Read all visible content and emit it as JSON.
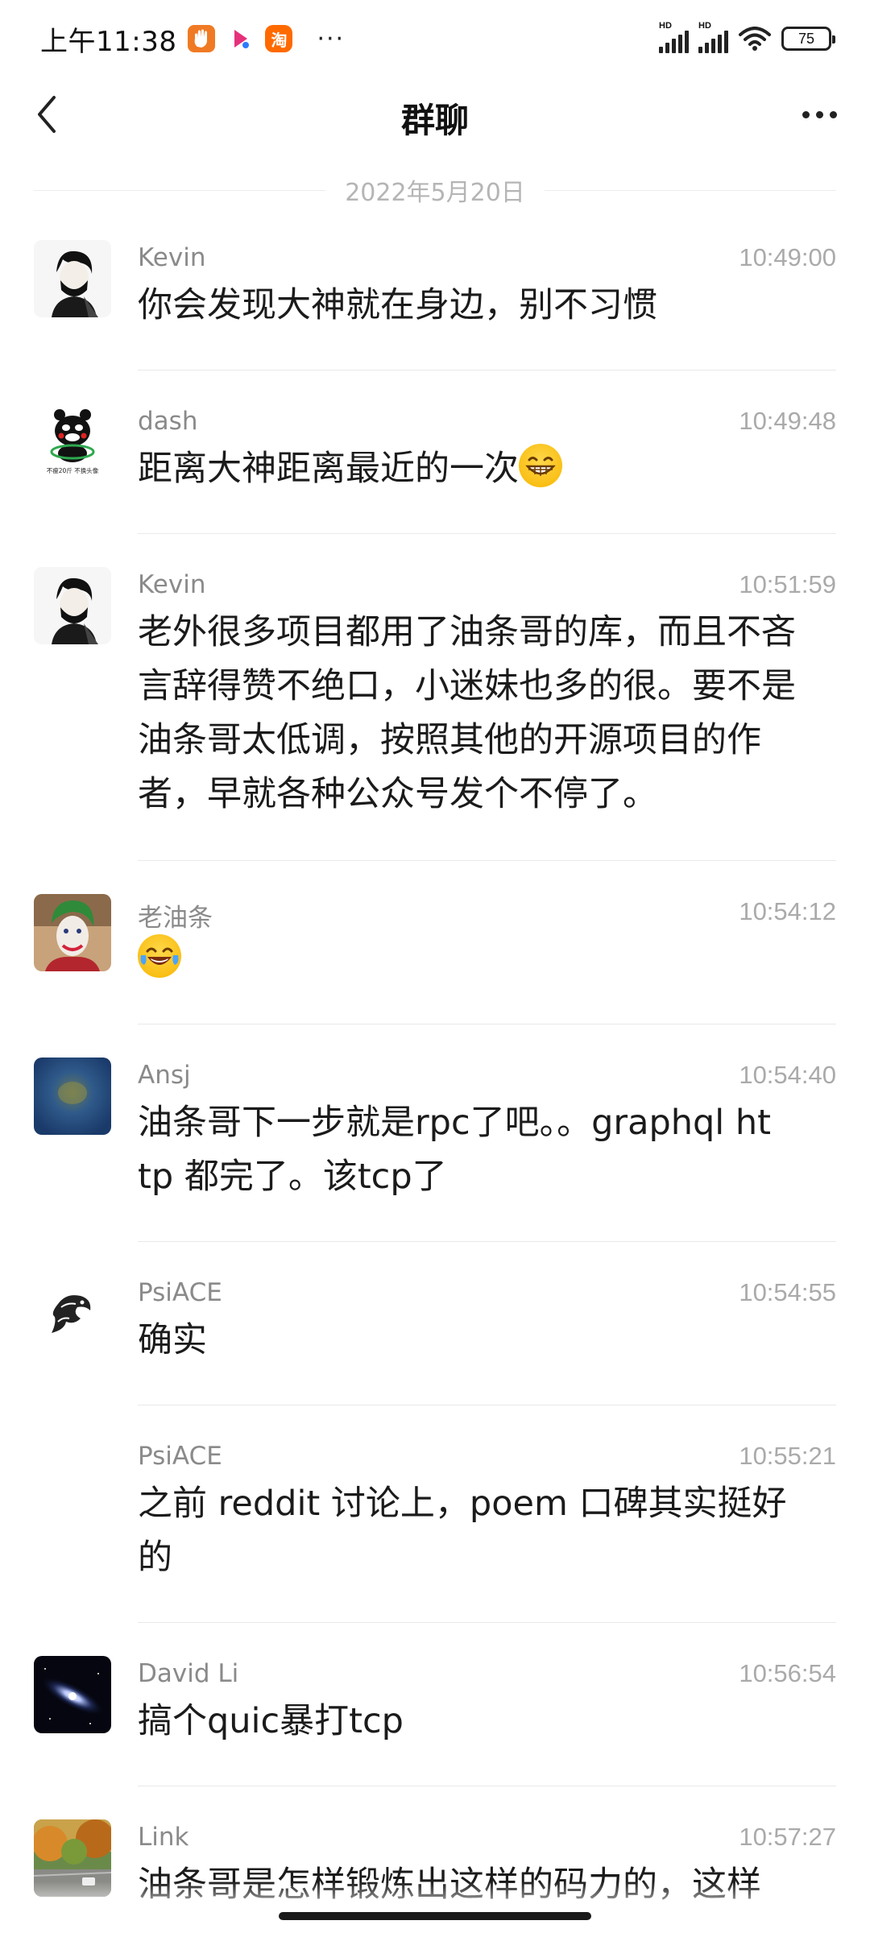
{
  "status_bar": {
    "time": "上午11:38",
    "app_icons": [
      "hand-app-icon",
      "video-app-icon",
      "taobao-icon"
    ],
    "taobao_label": "淘",
    "more": "···",
    "battery": "75"
  },
  "nav": {
    "title": "群聊"
  },
  "date_divider": "2022年5月20日",
  "messages": [
    {
      "name": "Kevin",
      "time": "10:49:00",
      "text": "你会发现大神就在身边，别不习惯"
    },
    {
      "name": "dash",
      "time": "10:49:48",
      "text": "距离大神距离最近的一次",
      "avatar_caption": "不瘦20斤 不换头像"
    },
    {
      "name": "Kevin",
      "time": "10:51:59",
      "text": "老外很多项目都用了油条哥的库，而且不吝言辞得赞不绝口，小迷妹也多的很。要不是油条哥太低调，按照其他的开源项目的作者，早就各种公众号发个不停了。"
    },
    {
      "name": "老油条",
      "time": "10:54:12",
      "text": ""
    },
    {
      "name": "Ansj",
      "time": "10:54:40",
      "text": "油条哥下一步就是rpc了吧。。graphql http 都完了。该tcp了"
    },
    {
      "name": "PsiACE",
      "time": "10:54:55",
      "text": "确实"
    },
    {
      "name": "PsiACE",
      "time": "10:55:21",
      "text": "之前 reddit 讨论上，poem 口碑其实挺好的"
    },
    {
      "name": "David Li",
      "time": "10:56:54",
      "text": "搞个quic暴打tcp"
    },
    {
      "name": "Link",
      "time": "10:57:27",
      "text": "油条哥是怎样锻炼出这样的码力的，这样"
    }
  ]
}
